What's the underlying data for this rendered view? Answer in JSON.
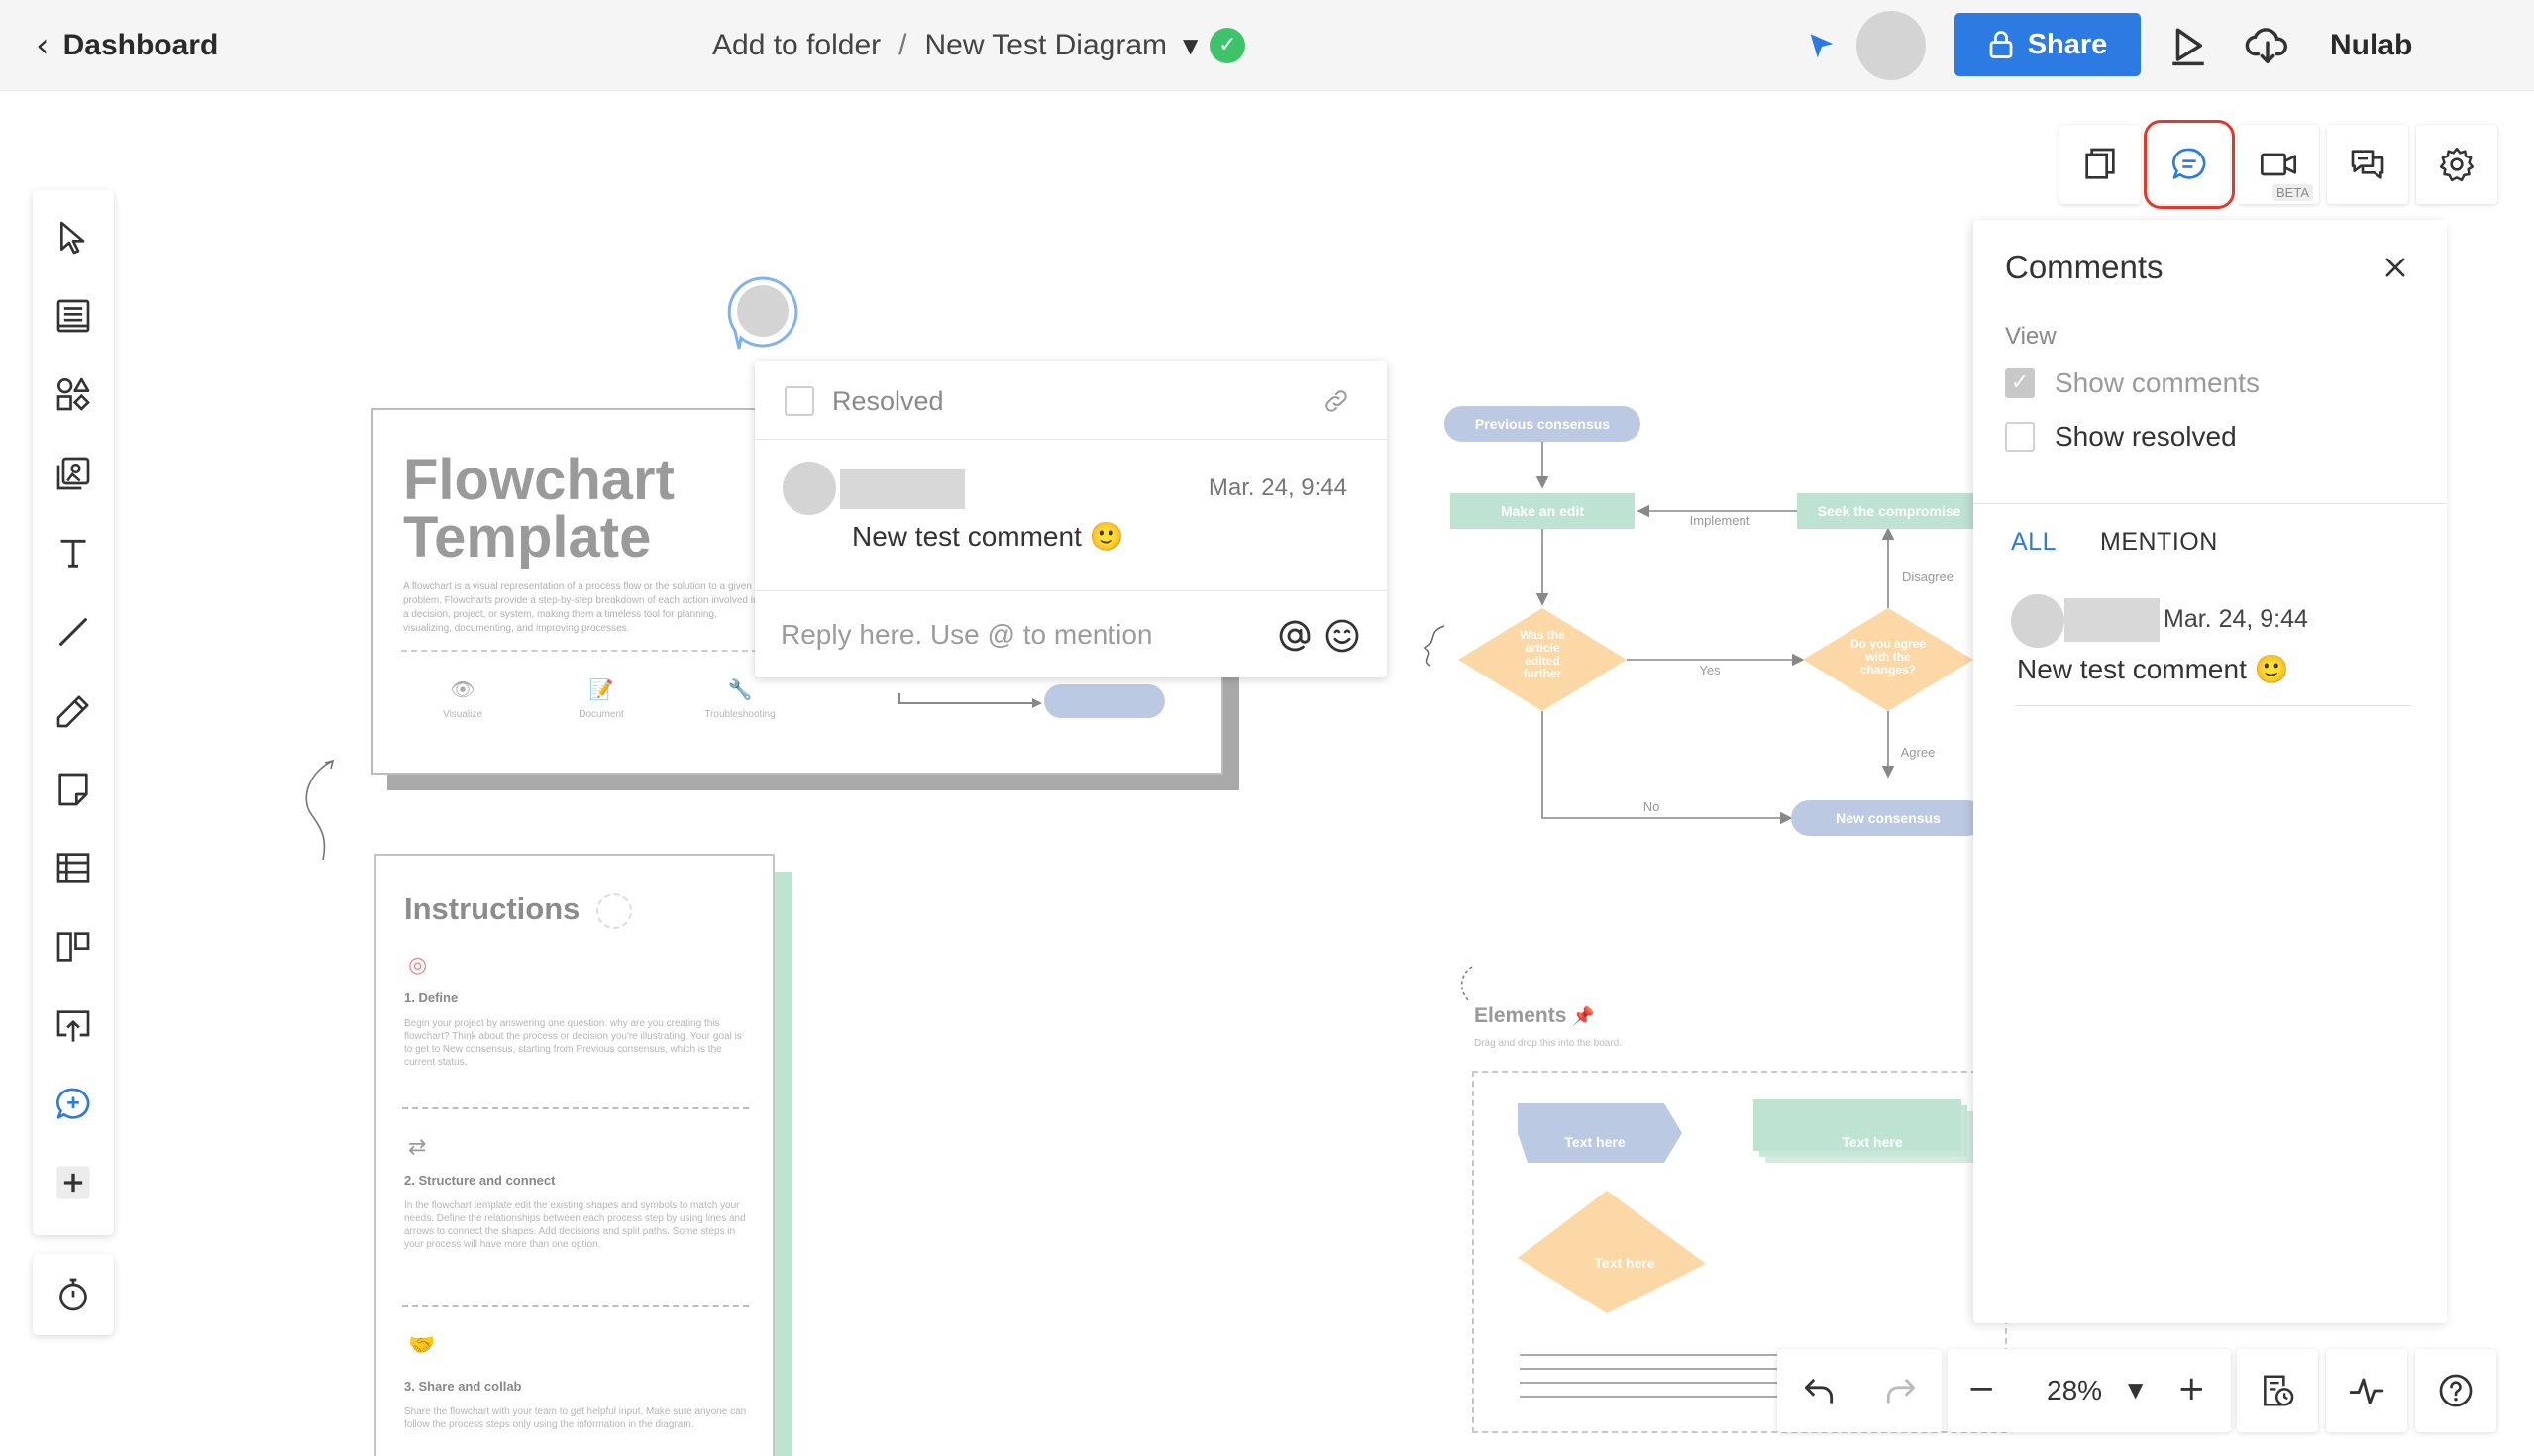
{
  "topbar": {
    "back_label": "Dashboard",
    "folder_label": "Add to folder",
    "separator": "/",
    "diagram_name": "New Test Diagram",
    "share_label": "Share",
    "brand": "Nulab",
    "icons": [
      "chevron-left-icon",
      "chevron-down-icon",
      "check-circle-icon",
      "cursor-icon",
      "lock-icon",
      "play-icon",
      "cloud-download-icon"
    ],
    "colors": {
      "share_bg": "#2b7be3",
      "saved": "#3ec36b"
    }
  },
  "left_toolbar": {
    "tools": [
      "select-tool",
      "template-tool",
      "shapes-tool",
      "image-tool",
      "text-tool",
      "line-tool",
      "pen-tool",
      "sticky-note-tool",
      "table-tool",
      "kanban-tool",
      "upload-tool",
      "comment-tool",
      "add-tool"
    ],
    "bottom_tool": "timer-tool"
  },
  "canvas": {
    "flow_card": {
      "title": "Flowchart Template",
      "description": "A flowchart is a visual representation of a process flow or the solution to a given problem. Flowcharts provide a step-by-step breakdown of each action involved in a decision, project, or system, making them a timeless tool for planning, visualizing, documenting, and improving processes.",
      "icons": [
        {
          "glyph": "👁",
          "label": "Visualize"
        },
        {
          "glyph": "📝",
          "label": "Document"
        },
        {
          "glyph": "🔧",
          "label": "Troubleshooting"
        }
      ]
    },
    "instructions": {
      "title": "Instructions",
      "sections": [
        {
          "icon": "◎",
          "title": "1. Define",
          "text": "Begin your project by answering one question: why are you creating this flowchart? Think about the process or decision you're illustrating. Your goal is to get to New consensus, starting from Previous consensus, which is the current status."
        },
        {
          "icon": "⇄",
          "title": "2. Structure and connect",
          "text": "In the flowchart template edit the existing shapes and symbols to match your needs. Define the relationships between each process step by using lines and arrows to connect the shapes. Add decisions and split paths. Some steps in your process will have more than one option."
        },
        {
          "icon": "🤝",
          "title": "3. Share and collab",
          "text": "Share the flowchart with your team to get helpful input. Make sure anyone can follow the process steps only using the information in the diagram."
        }
      ]
    },
    "flowchart": {
      "previous": "Previous consensus",
      "make_edit": "Make an edit",
      "implement": "Implement",
      "seek": "Seek the compromise",
      "disagree": "Disagree",
      "was_article": [
        "Was the",
        "article",
        "edited",
        "further"
      ],
      "yes": "Yes",
      "do_you_agree": [
        "Do you agree",
        "with the",
        "changes?"
      ],
      "agree": "Agree",
      "no": "No",
      "new_consensus": "New consensus"
    },
    "elements": {
      "title": "Elements",
      "pin_icon": "pushpin-icon",
      "subtitle": "Drag and drop this into the board.",
      "shape1": "Text here",
      "shape2": "Text here",
      "shape3": "Text here"
    }
  },
  "comment_popup": {
    "resolved_label": "Resolved",
    "resolved_checked": false,
    "time": "Mar. 24, 9:44",
    "text": "New test comment 🙂",
    "reply_placeholder": "Reply here. Use @ to mention"
  },
  "right_tools": {
    "items": [
      "pages-icon",
      "comments-icon",
      "video-icon",
      "chat-icon",
      "settings-icon"
    ],
    "beta_label": "BETA",
    "active": "comments-icon"
  },
  "comments_panel": {
    "title": "Comments",
    "view_label": "View",
    "show_comments": "Show comments",
    "show_comments_checked": true,
    "show_resolved": "Show resolved",
    "show_resolved_checked": false,
    "tab_all": "ALL",
    "tab_mention": "MENTION",
    "active_tab": "ALL",
    "comment_time": "Mar. 24, 9:44",
    "comment_text": "New test comment 🙂"
  },
  "bottom_toolbar": {
    "zoom": "28%",
    "icons": [
      "undo-icon",
      "redo-icon",
      "zoom-out-icon",
      "zoom-in-icon",
      "history-icon",
      "activity-icon",
      "help-icon"
    ]
  }
}
